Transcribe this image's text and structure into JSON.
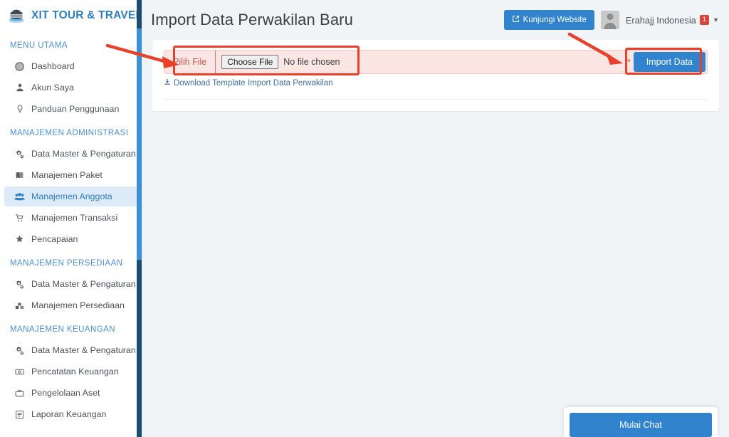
{
  "colors": {
    "brand_blue": "#2c7fc4",
    "accent_blue": "#3083cc",
    "active_bg": "#ddeaf8",
    "annotation_red": "#e8402a",
    "badge_red": "#d9453c",
    "scrollbar_thumb": "#3b8fd4",
    "scrollbar_track": "#1b4f72",
    "page_bg": "#f0f4f7",
    "form_pink": "#fbe6e4"
  },
  "sidebar": {
    "brand": {
      "logo_icon": "travel-logo-icon",
      "title": "XIT TOUR & TRAVEL"
    },
    "sections": [
      {
        "heading": "MENU UTAMA",
        "items": [
          {
            "label": "Dashboard",
            "icon": "globe-icon",
            "active": false
          },
          {
            "label": "Akun Saya",
            "icon": "user-icon",
            "active": false
          },
          {
            "label": "Panduan Penggunaan",
            "icon": "lightbulb-icon",
            "active": false
          }
        ]
      },
      {
        "heading": "MANAJEMEN ADMINISTRASI",
        "items": [
          {
            "label": "Data Master & Pengaturan",
            "icon": "gears-icon",
            "active": false
          },
          {
            "label": "Manajemen Paket",
            "icon": "book-icon",
            "active": false
          },
          {
            "label": "Manajemen Anggota",
            "icon": "users-icon",
            "active": true
          },
          {
            "label": "Manajemen Transaksi",
            "icon": "cart-icon",
            "active": false
          },
          {
            "label": "Pencapaian",
            "icon": "award-icon",
            "active": false
          }
        ]
      },
      {
        "heading": "MANAJEMEN PERSEDIAAN",
        "items": [
          {
            "label": "Data Master & Pengaturan",
            "icon": "gears-icon",
            "active": false
          },
          {
            "label": "Manajemen Persediaan",
            "icon": "boxes-icon",
            "active": false
          }
        ]
      },
      {
        "heading": "MANAJEMEN KEUANGAN",
        "items": [
          {
            "label": "Data Master & Pengaturan",
            "icon": "gears-icon",
            "active": false
          },
          {
            "label": "Pencatatan Keuangan",
            "icon": "money-icon",
            "active": false
          },
          {
            "label": "Pengelolaan Aset",
            "icon": "briefcase-icon",
            "active": false
          },
          {
            "label": "Laporan Keuangan",
            "icon": "report-icon",
            "active": false
          }
        ]
      }
    ]
  },
  "header": {
    "page_title": "Import Data Perwakilan Baru",
    "visit_button": {
      "label": "Kunjungi Website",
      "icon": "external-link-icon"
    },
    "user": {
      "name": "Erahajj Indonesia",
      "badge": "1",
      "caret_icon": "caret-down-icon",
      "avatar_icon": "avatar-icon"
    }
  },
  "form": {
    "file_label": "Pilih File",
    "choose_button": "Choose File",
    "no_file_text": "No file chosen",
    "required_mark": "*",
    "import_button": "Import Data",
    "download_link": "Download Template Import Data Perwakilan",
    "download_icon": "download-icon"
  },
  "chat": {
    "button_label": "Mulai Chat"
  }
}
